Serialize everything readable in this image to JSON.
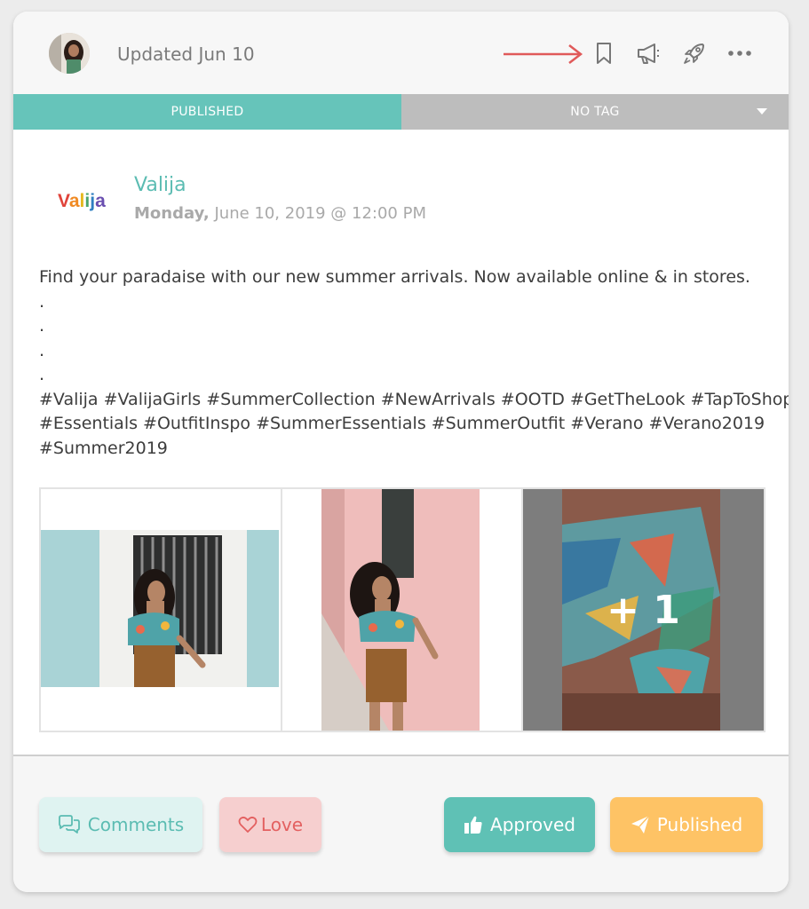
{
  "header": {
    "updated_text": "Updated Jun 10",
    "icons": [
      "bookmark-icon",
      "megaphone-icon",
      "rocket-icon",
      "more-icon"
    ]
  },
  "status": {
    "published_label": "PUBLISHED",
    "tag_label": "NO TAG"
  },
  "post": {
    "brand_logo_text": "Valija",
    "brand_name": "Valija",
    "date_day": "Monday,",
    "date_rest": "June 10, 2019 @ 12:00 PM",
    "caption_lines": [
      "Find your paradaise with our new summer arrivals. Now available online & in stores.",
      ".",
      ".",
      ".",
      ".",
      "#Valija #ValijaGirls #SummerCollection #NewArrivals #OOTD #GetTheLook #TapToShop",
      "#Essentials #OutfitInspo #SummerEssentials #SummerOutfit #Verano #Verano2019",
      "#Summer2019"
    ],
    "extra_images_label": "+ 1"
  },
  "actions": {
    "comments_label": "Comments",
    "love_label": "Love",
    "approved_label": "Approved",
    "published_label": "Published"
  },
  "colors": {
    "teal": "#66c4ba",
    "gray_tag": "#bdbdbd",
    "comments_bg": "#dff3f1",
    "love_bg": "#f6cfcf",
    "approved_bg": "#5fc1b5",
    "published_bg": "#fec365",
    "annotation_arrow": "#e05a5a"
  }
}
